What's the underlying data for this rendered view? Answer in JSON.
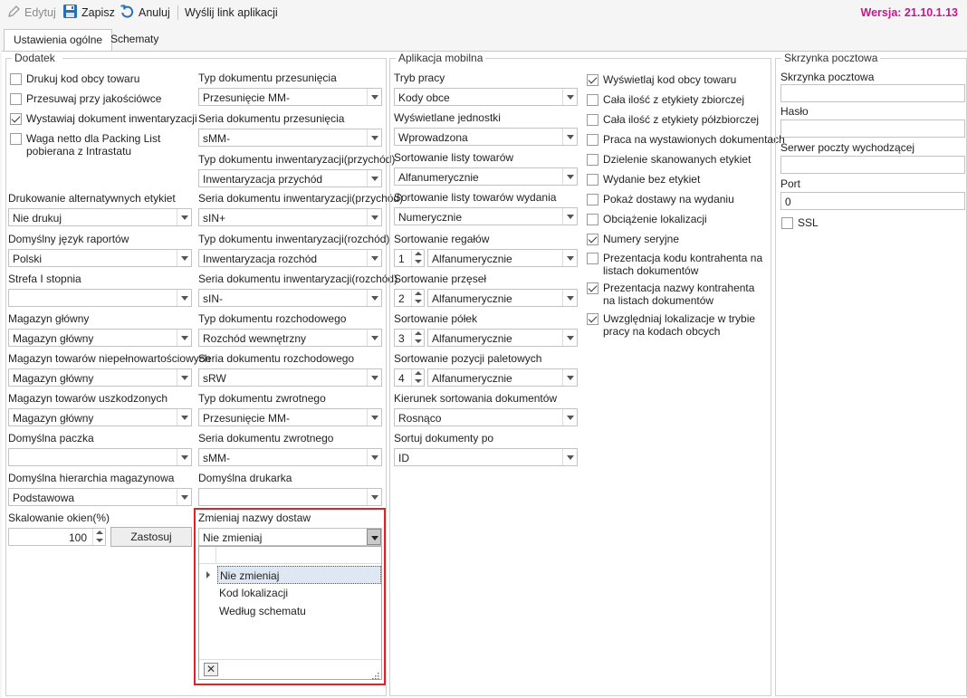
{
  "toolbar": {
    "edit_label": "Edytuj",
    "save_label": "Zapisz",
    "cancel_label": "Anuluj",
    "send_link_label": "Wyślij link aplikacji",
    "version": "Wersja: 21.10.1.13",
    "colors": {
      "version": "#c8158e",
      "save_icon": "#2a6fb5"
    }
  },
  "tabs": [
    {
      "label": "Ustawienia ogólne",
      "active": true
    },
    {
      "label": "Schematy",
      "active": false
    }
  ],
  "dodatek": {
    "title": "Dodatek",
    "checkboxes": [
      {
        "label": "Drukuj kod obcy towaru",
        "checked": false
      },
      {
        "label": "Przesuwaj przy jakościówce",
        "checked": false
      },
      {
        "label": "Wystawiaj dokument inwentaryzacji",
        "checked": true
      },
      {
        "label": "Waga netto dla Packing List pobierana z Intrastatu",
        "checked": false
      }
    ],
    "left_fields": [
      {
        "label": "Drukowanie alternatywnych etykiet",
        "value": "Nie drukuj"
      },
      {
        "label": "Domyślny język raportów",
        "value": "Polski"
      },
      {
        "label": "Strefa I stopnia",
        "value": ""
      },
      {
        "label": "Magazyn główny",
        "value": "Magazyn główny"
      },
      {
        "label": "Magazyn towarów niepełnowartościowych",
        "value": "Magazyn główny"
      },
      {
        "label": "Magazyn towarów uszkodzonych",
        "value": "Magazyn główny"
      },
      {
        "label": "Domyślna paczka",
        "value": ""
      },
      {
        "label": "Domyślna hierarchia magazynowa",
        "value": "Podstawowa"
      }
    ],
    "scaling": {
      "label": "Skalowanie okien(%)",
      "value": "100",
      "apply_label": "Zastosuj"
    },
    "right_fields": [
      {
        "label": "Typ dokumentu przesunięcia",
        "value": "Przesunięcie MM-"
      },
      {
        "label": "Seria dokumentu przesunięcia",
        "value": "sMM-"
      },
      {
        "label": "Typ dokumentu inwentaryzacji(przychód)",
        "value": "Inwentaryzacja przychód"
      },
      {
        "label": "Seria dokumentu inwentaryzacji(przychód)",
        "value": "sIN+"
      },
      {
        "label": "Typ dokumentu inwentaryzacji(rozchód)",
        "value": "Inwentaryzacja rozchód"
      },
      {
        "label": "Seria dokumentu inwentaryzacji(rozchód)",
        "value": "sIN-"
      },
      {
        "label": "Typ dokumentu rozchodowego",
        "value": "Rozchód wewnętrzny"
      },
      {
        "label": "Seria dokumentu rozchodowego",
        "value": "sRW"
      },
      {
        "label": "Typ dokumentu zwrotnego",
        "value": "Przesunięcie MM-"
      },
      {
        "label": "Seria dokumentu zwrotnego",
        "value": "sMM-"
      },
      {
        "label": "Domyślna drukarka",
        "value": ""
      }
    ],
    "rename_deliveries": {
      "label": "Zmieniaj nazwy dostaw",
      "value": "Nie zmieniaj",
      "options": [
        "Nie zmieniaj",
        "Kod lokalizacji",
        "Według schematu"
      ],
      "selected_index": 0,
      "highlight_color": "#d9252a"
    }
  },
  "mobile": {
    "title": "Aplikacja mobilna",
    "fields": [
      {
        "label": "Tryb pracy",
        "value": "Kody obce"
      },
      {
        "label": "Wyświetlane jednostki",
        "value": "Wprowadzona"
      },
      {
        "label": "Sortowanie listy towarów",
        "value": "Alfanumerycznie"
      },
      {
        "label": "Sortowanie listy towarów wydania",
        "value": "Numerycznie"
      }
    ],
    "spin_fields": [
      {
        "label": "Sortowanie regałów",
        "num": "1",
        "value": "Alfanumerycznie"
      },
      {
        "label": "Sortowanie przęseł",
        "num": "2",
        "value": "Alfanumerycznie"
      },
      {
        "label": "Sortowanie półek",
        "num": "3",
        "value": "Alfanumerycznie"
      },
      {
        "label": "Sortowanie pozycji paletowych",
        "num": "4",
        "value": "Alfanumerycznie"
      }
    ],
    "bottom_fields": [
      {
        "label": "Kierunek sortowania dokumentów",
        "value": "Rosnąco"
      },
      {
        "label": "Sortuj dokumenty po",
        "value": "ID"
      }
    ],
    "checkboxes": [
      {
        "label": "Wyświetlaj kod obcy towaru",
        "checked": true
      },
      {
        "label": "Cała ilość z etykiety zbiorczej",
        "checked": false
      },
      {
        "label": "Cała ilość z etykiety półzbiorczej",
        "checked": false
      },
      {
        "label": "Praca na wystawionych dokumentach",
        "checked": false
      },
      {
        "label": "Dzielenie skanowanych etykiet",
        "checked": false
      },
      {
        "label": "Wydanie bez etykiet",
        "checked": false
      },
      {
        "label": "Pokaż dostawy na wydaniu",
        "checked": false
      },
      {
        "label": "Obciążenie lokalizacji",
        "checked": false
      },
      {
        "label": "Numery seryjne",
        "checked": true
      },
      {
        "label": "Prezentacja kodu kontrahenta na listach dokumentów",
        "checked": false
      },
      {
        "label": "Prezentacja nazwy kontrahenta na listach dokumentów",
        "checked": true
      },
      {
        "label": "Uwzględniaj lokalizacje w trybie pracy na kodach obcych",
        "checked": true
      }
    ]
  },
  "mailbox": {
    "title": "Skrzynka pocztowa",
    "fields": [
      {
        "label": "Skrzynka pocztowa",
        "value": ""
      },
      {
        "label": "Hasło",
        "value": ""
      },
      {
        "label": "Serwer poczty wychodzącej",
        "value": ""
      },
      {
        "label": "Port",
        "value": "0"
      }
    ],
    "ssl": {
      "label": "SSL",
      "checked": false
    }
  }
}
